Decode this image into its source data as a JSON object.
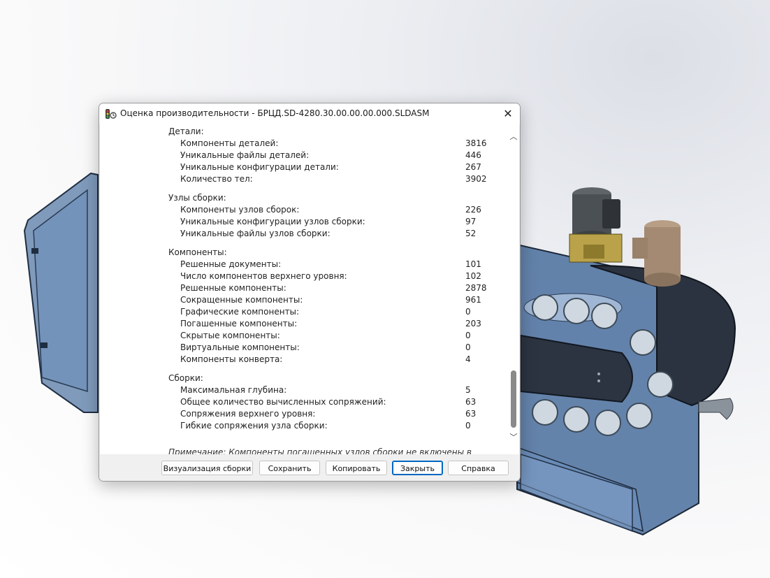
{
  "window": {
    "title": "Оценка производительности - БРЦД.SD-4280.30.00.00.00.000.SLDASM",
    "close_glyph": "✕"
  },
  "sections": [
    {
      "title": "Детали:",
      "rows": [
        {
          "label": "Компоненты деталей:",
          "value": "3816"
        },
        {
          "label": "Уникальные файлы деталей:",
          "value": "446"
        },
        {
          "label": "Уникальные конфигурации детали:",
          "value": "267"
        },
        {
          "label": "Количество тел:",
          "value": "3902"
        }
      ]
    },
    {
      "title": "Узлы сборки:",
      "rows": [
        {
          "label": "Компоненты узлов сборок:",
          "value": "226"
        },
        {
          "label": "Уникальные конфигурации узлов сборки:",
          "value": "97"
        },
        {
          "label": "Уникальные файлы узлов сборки:",
          "value": "52"
        }
      ]
    },
    {
      "title": "Компоненты:",
      "rows": [
        {
          "label": "Решенные документы:",
          "value": "101"
        },
        {
          "label": "Число компонентов верхнего уровня:",
          "value": "102"
        },
        {
          "label": "Решенные компоненты:",
          "value": "2878"
        },
        {
          "label": "Сокращенные компоненты:",
          "value": "961"
        },
        {
          "label": "Графические компоненты:",
          "value": "0"
        },
        {
          "label": "Погашенные компоненты:",
          "value": "203"
        },
        {
          "label": "Скрытые компоненты:",
          "value": "0"
        },
        {
          "label": "Виртуальные компоненты:",
          "value": "0"
        },
        {
          "label": "Компоненты конверта:",
          "value": "4"
        }
      ]
    },
    {
      "title": "Сборки:",
      "rows": [
        {
          "label": "Максимальная глубина:",
          "value": "5"
        },
        {
          "label": "Общее количество вычисленных сопряжений:",
          "value": "63"
        },
        {
          "label": "Сопряжения верхнего уровня:",
          "value": "63"
        },
        {
          "label": "Гибкие сопряжения узла сборки:",
          "value": "0"
        }
      ]
    }
  ],
  "note": "Примечание: Компоненты погашенных узлов сборки не включены в",
  "buttons": {
    "visualize": "Визуализация сборки",
    "save": "Сохранить",
    "copy": "Копировать",
    "close": "Закрыть",
    "help": "Справка"
  },
  "scrollbar": {
    "up_glyph": "︿",
    "down_glyph": "﹀",
    "position_fraction": 0.88
  },
  "colors": {
    "accent": "#0067c0",
    "model_blue": "#4a6f9e",
    "model_dark": "#2f3f55"
  }
}
